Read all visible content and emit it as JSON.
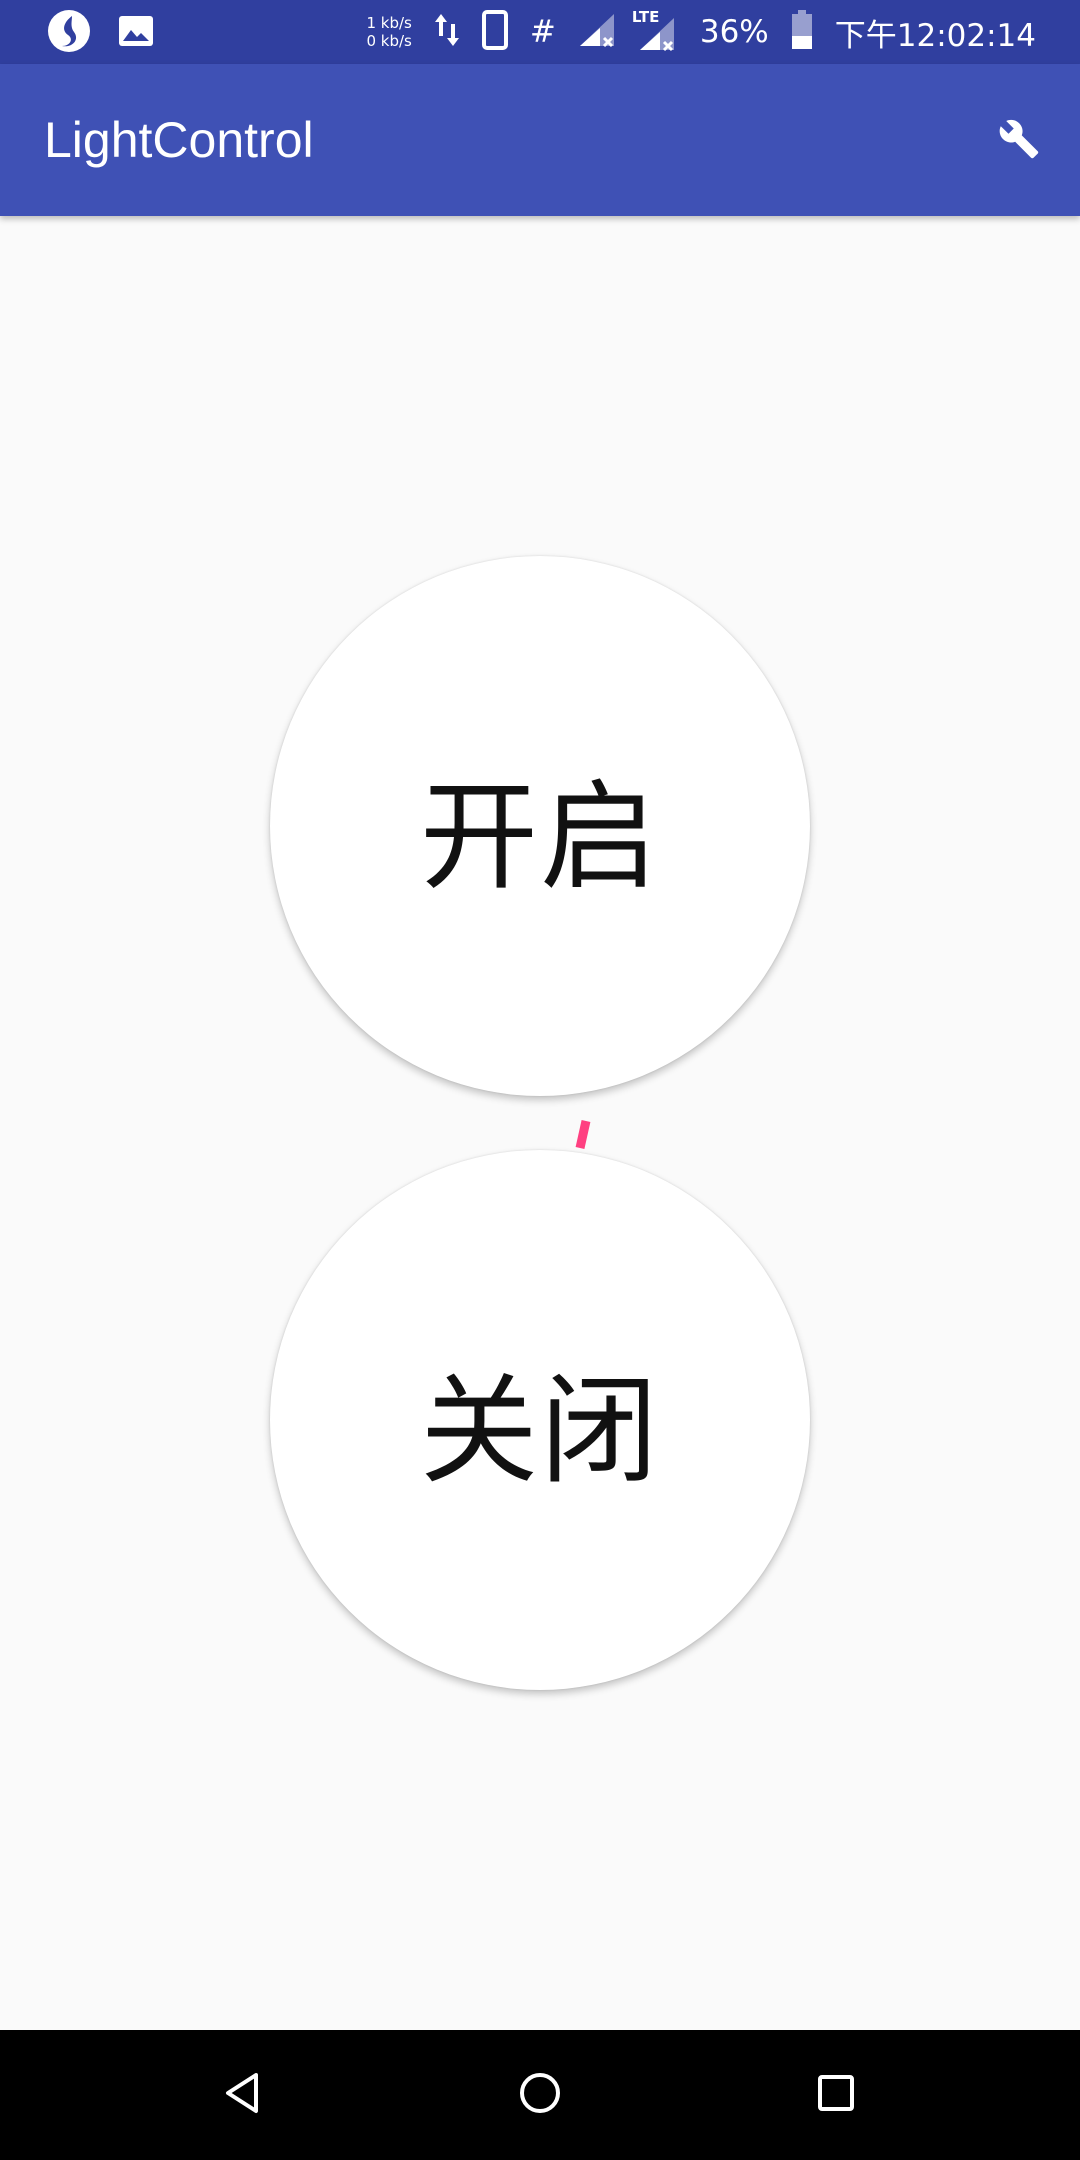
{
  "status_bar": {
    "net_up": "1 kb/s",
    "net_down": "0 kb/s",
    "lte_label": "LTE",
    "hash_symbol": "#",
    "battery_percent": "36%",
    "time": "下午12:02:14",
    "icons": [
      "app-notification-icon",
      "image-icon",
      "data-transfer-icon",
      "phone-icon",
      "hash-icon",
      "signal-icon",
      "lte-signal-icon",
      "battery-icon"
    ]
  },
  "app_bar": {
    "title": "LightControl",
    "settings_icon": "wrench-icon"
  },
  "buttons": {
    "on_label": "开启",
    "off_label": "关闭"
  },
  "nav_bar": {
    "icons": [
      "back-icon",
      "home-icon",
      "recent-apps-icon"
    ]
  },
  "colors": {
    "status_bar": "#303f9f",
    "app_bar": "#3f51b5",
    "background": "#fafafa",
    "accent": "#ff4081"
  }
}
